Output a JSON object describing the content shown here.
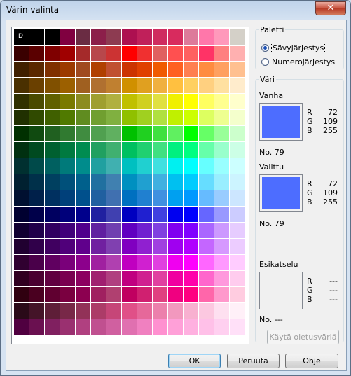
{
  "window": {
    "title": "Värin valinta",
    "close_label": "✕"
  },
  "palette": {
    "legend": "Paletti",
    "options": [
      "Sävyjärjestys",
      "Numerojärjestys"
    ],
    "selected": 0,
    "marker": "D",
    "rows": [
      [
        "#ffffff",
        "#000000",
        "#000000",
        "#800040",
        "#6a2c43",
        "#8c1f4a",
        "#8d3b51",
        "#ad1050",
        "#c0205a",
        "#cf2c5f",
        "#d82b5e",
        "#dd7a9a",
        "#ff77aa",
        "#ff99bb",
        "#d4d0c8"
      ],
      [
        "#3a0000",
        "#5a0000",
        "#7f0000",
        "#a00000",
        "#a52a2a",
        "#b8474b",
        "#cc3333",
        "#ff0000",
        "#f03030",
        "#e06060",
        "#ff5050",
        "#ff6060",
        "#ff3366",
        "#ff8080",
        "#ffb0b0"
      ],
      [
        "#402000",
        "#5a2800",
        "#7f3000",
        "#9c3a00",
        "#a04a20",
        "#b04000",
        "#c05030",
        "#cc3300",
        "#e04000",
        "#f05a00",
        "#ff6020",
        "#ff7f50",
        "#ff8c40",
        "#ffa060",
        "#ffc090"
      ],
      [
        "#4a3000",
        "#6a4000",
        "#805000",
        "#9c6000",
        "#a06020",
        "#b07030",
        "#c08030",
        "#d09000",
        "#e0a020",
        "#f0b040",
        "#ffc040",
        "#ffd060",
        "#ffd080",
        "#ffe0a0",
        "#ffeccc"
      ],
      [
        "#303000",
        "#4a4a00",
        "#606000",
        "#7a7a00",
        "#8c8c20",
        "#9f9f30",
        "#b0b040",
        "#c0c000",
        "#d0d020",
        "#e0e040",
        "#f0f000",
        "#ffff00",
        "#ffff60",
        "#ffff90",
        "#ffffcc"
      ],
      [
        "#203000",
        "#304a00",
        "#406000",
        "#507a00",
        "#608c20",
        "#709f30",
        "#80b040",
        "#90c000",
        "#a0d020",
        "#b0e040",
        "#c0f000",
        "#ccff00",
        "#ddff60",
        "#eeff90",
        "#f4ffcc"
      ],
      [
        "#003000",
        "#104a10",
        "#206020",
        "#307a30",
        "#408c40",
        "#50a050",
        "#60b060",
        "#00c000",
        "#20d020",
        "#40e040",
        "#60f060",
        "#00ff00",
        "#66ff66",
        "#99ff99",
        "#ccffcc"
      ],
      [
        "#003010",
        "#004a20",
        "#006030",
        "#007a40",
        "#008c50",
        "#20a060",
        "#40b070",
        "#00c060",
        "#20d070",
        "#40e080",
        "#00f080",
        "#00ff80",
        "#66ffaa",
        "#99ffcc",
        "#ccffe6"
      ],
      [
        "#003030",
        "#004a4a",
        "#006060",
        "#007a7a",
        "#008c8c",
        "#20a0a0",
        "#40b0b0",
        "#00c0c0",
        "#20d0d0",
        "#40e0e0",
        "#00f0f0",
        "#00ffff",
        "#66ffff",
        "#99ffff",
        "#ccffff"
      ],
      [
        "#002030",
        "#00304a",
        "#004060",
        "#00507a",
        "#00608c",
        "#2070a0",
        "#4080b0",
        "#0090c0",
        "#20a0d0",
        "#40b0e0",
        "#00c0f0",
        "#00ccff",
        "#66ddff",
        "#99eeff",
        "#ccf4ff"
      ],
      [
        "#001030",
        "#00204a",
        "#003060",
        "#00407a",
        "#00508c",
        "#2060a0",
        "#4070b0",
        "#0070c0",
        "#2080d0",
        "#4090e0",
        "#00a0f0",
        "#0099ff",
        "#66bbff",
        "#99ccff",
        "#cce6ff"
      ],
      [
        "#000030",
        "#00004a",
        "#000060",
        "#00007a",
        "#00008c",
        "#2020a0",
        "#4040b0",
        "#0000c0",
        "#2020d0",
        "#4040e0",
        "#0000f0",
        "#0000ff",
        "#6666ff",
        "#9999ff",
        "#ccccff"
      ],
      [
        "#100030",
        "#20004a",
        "#300060",
        "#40007a",
        "#50008c",
        "#6020a0",
        "#7040b0",
        "#6000c0",
        "#7020d0",
        "#8040e0",
        "#8000f0",
        "#8000ff",
        "#aa66ff",
        "#cc99ff",
        "#e6ccff"
      ],
      [
        "#200030",
        "#30004a",
        "#400060",
        "#50007a",
        "#60008c",
        "#7020a0",
        "#8040b0",
        "#8000c0",
        "#9020d0",
        "#a040e0",
        "#a000f0",
        "#b000ff",
        "#c466ff",
        "#d699ff",
        "#ecccff"
      ],
      [
        "#300030",
        "#4a004a",
        "#600060",
        "#7a007a",
        "#8c008c",
        "#a020a0",
        "#b040b0",
        "#c000c0",
        "#d020d0",
        "#e040e0",
        "#f000f0",
        "#ff00ff",
        "#ff66ff",
        "#ff99ff",
        "#ffccff"
      ],
      [
        "#300020",
        "#4a0030",
        "#600040",
        "#7a0050",
        "#8c0060",
        "#a02070",
        "#b04080",
        "#c00080",
        "#d02090",
        "#e040a0",
        "#f000a0",
        "#ff00aa",
        "#ff66cc",
        "#ff99dd",
        "#ffccee"
      ],
      [
        "#300010",
        "#4a0020",
        "#600030",
        "#7a0040",
        "#8c0050",
        "#a02060",
        "#b04070",
        "#c00060",
        "#d02070",
        "#e04080",
        "#f00080",
        "#ff0080",
        "#ff66aa",
        "#ff99cc",
        "#ffcce0"
      ],
      [
        "#2a0a18",
        "#441428",
        "#5e1e38",
        "#782848",
        "#923258",
        "#ac3c68",
        "#c64678",
        "#e05088",
        "#e6689a",
        "#ec80ac",
        "#f298be",
        "#f8b0d0",
        "#fcc8e0",
        "#fee0f0",
        "#fff0f8"
      ],
      [
        "#500040",
        "#6a1050",
        "#802060",
        "#9a3070",
        "#b04080",
        "#c05090",
        "#d060a0",
        "#e070b0",
        "#f080c0",
        "#ff90d0",
        "#ffa0d8",
        "#ffb0e0",
        "#ffc0e8",
        "#ffd0f0",
        "#ffe0f8"
      ]
    ]
  },
  "colour": {
    "legend": "Väri",
    "old_label": "Vanha",
    "old": {
      "hex": "#4d6dff",
      "r": "72",
      "g": "109",
      "b": "255",
      "no": "No. 79"
    },
    "sel_label": "Valittu",
    "sel": {
      "hex": "#4d6dff",
      "r": "72",
      "g": "109",
      "b": "255",
      "no": "No. 79"
    },
    "preview_label": "Esikatselu",
    "preview": {
      "hex": "#f0f0f0",
      "r": "---",
      "g": "---",
      "b": "---",
      "no": "No. ---"
    },
    "use_default": "Käytä oletusväriä"
  },
  "rgb_letters": {
    "r": "R",
    "g": "G",
    "b": "B"
  },
  "buttons": {
    "ok": "OK",
    "cancel": "Peruuta",
    "help": "Ohje"
  }
}
